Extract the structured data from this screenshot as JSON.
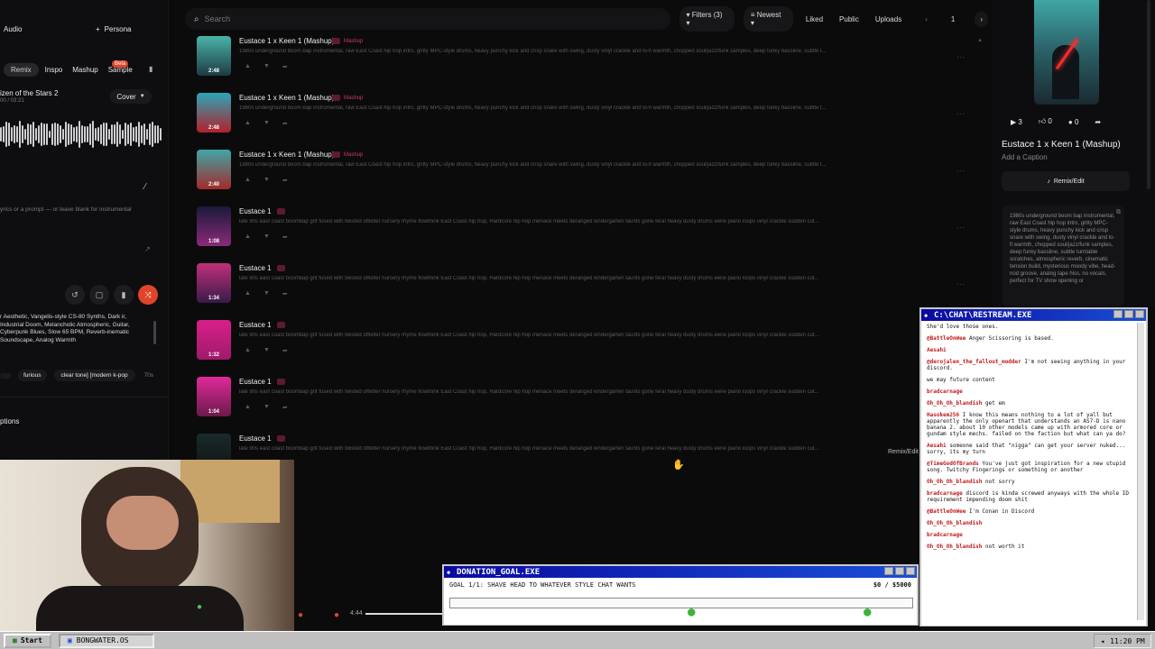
{
  "left": {
    "audio_label": "Audio",
    "persona_label": "Persona",
    "mode_tabs": [
      "Remix",
      "Inspo",
      "Mashup",
      "Sample"
    ],
    "beta_badge": "Beta",
    "track_title": "izen of the Stars 2",
    "track_time": "00 / 03:21",
    "cover_label": "Cover",
    "lyrics_placeholder": "yrics or a prompt — or leave blank for instrumental",
    "style_text": "r Aesthetic, Vangelis-style CS-80 Synths, Dark ir, Industrial Doom, Melancholic Atmospheric, Guitar, Cyberpunk Blues, Slow 65 BPM, Reverb-inematic Soundscape, Analog Warmth",
    "style_tags": [
      "furious",
      "clear tone] [modern k-pop",
      "70s"
    ],
    "options_label": "ptions"
  },
  "topbar": {
    "search_placeholder": "Search",
    "filters_label": "Filters (3)",
    "sort_label": "Newest",
    "liked_label": "Liked",
    "public_label": "Public",
    "uploads_label": "Uploads",
    "page_number": "1"
  },
  "songs": [
    {
      "title": "Eustace 1 x Keen 1 (Mashup)",
      "tag": "Mashup",
      "duration": "2:48",
      "desc": "1980s underground boom bap instrumental, raw East Coast hip hop intro, gritty MPC-style drums, heavy punchy kick and crisp snare with swing, dusty vinyl crackle and lo-fi warmth, chopped soul/jazz/funk samples, deep funky bassline, subtle t..."
    },
    {
      "title": "Eustace 1 x Keen 1 (Mashup)",
      "tag": "Mashup",
      "duration": "2:48",
      "desc": "1980s underground boom bap instrumental, raw East Coast hip hop intro, gritty MPC-style drums, heavy punchy kick and crisp snare with swing, dusty vinyl crackle and lo-fi warmth, chopped soul/jazz/funk samples, deep funky bassline, subtle t..."
    },
    {
      "title": "Eustace 1 x Keen 1 (Mashup)",
      "tag": "Mashup",
      "duration": "2:40",
      "desc": "1980s underground boom bap instrumental, raw East Coast hip hop intro, gritty MPC-style drums, heavy punchy kick and crisp snare with swing, dusty vinyl crackle and lo-fi warmth, chopped soul/jazz/funk samples, deep funky bassline, subtle t..."
    },
    {
      "title": "Eustace 1",
      "tag": "",
      "duration": "1:08",
      "desc": "late 90s east coast boombap grit fused with twisted offkilter nursery rhyme flowthink East Coast hip hop, Hardcore hip hop menace meets deranged kindergarten taunts gone feral heavy dusty drums eerie piano loops vinyl crackle sudden cut..."
    },
    {
      "title": "Eustace 1",
      "tag": "",
      "duration": "1:34",
      "desc": "late 90s east coast boombap grit fused with twisted offkilter nursery rhyme flowthink East Coast hip hop, Hardcore hip hop menace meets deranged kindergarten taunts gone feral heavy dusty drums eerie piano loops vinyl crackle sudden cut..."
    },
    {
      "title": "Eustace 1",
      "tag": "",
      "duration": "1:32",
      "desc": "late 90s east coast boombap grit fused with twisted offkilter nursery rhyme flowthink East Coast hip hop, Hardcore hip hop menace meets deranged kindergarten taunts gone feral heavy dusty drums eerie piano loops vinyl crackle sudden cut..."
    },
    {
      "title": "Eustace 1",
      "tag": "",
      "duration": "1:04",
      "desc": "late 90s east coast boombap grit fused with twisted offkilter nursery rhyme flowthink East Coast hip hop, Hardcore hip hop menace meets deranged kindergarten taunts gone feral heavy dusty drums eerie piano loops vinyl crackle sudden cut..."
    },
    {
      "title": "Eustace 1",
      "tag": "",
      "duration": "",
      "desc": "late 90s east coast boombap grit fused with twisted offkilter nursery rhyme flowthink East Coast hip hop, Hardcore hip hop menace meets deranged kindergarten taunts gone feral heavy dusty drums eerie piano loops vinyl crackle sudden cut..."
    }
  ],
  "remix_edit_hover": "Remix/Edit",
  "detail": {
    "plays": "3",
    "likes": "0",
    "comments": "0",
    "title": "Eustace 1 x Keen 1 (Mashup)",
    "caption": "Add a Caption",
    "remix_button": "Remix/Edit",
    "description": "1980s underground boom bap instrumental, raw East Coast hip hop intro, gritty MPC-style drums, heavy punchy kick and crisp snare with swing, dusty vinyl crackle and lo-fi warmth, chopped soul/jazz/funk samples, deep funky bassline, subtle turntable scratches, atmospheric reverb, cinematic tension build, mysterious moody vibe, head-nod groove, analog tape hiss, no vocals, perfect for TV show opening or"
  },
  "chat": {
    "title": "C:\\CHAT\\RESTREAM.EXE",
    "messages": [
      {
        "name": "",
        "text": "She'd love those ones."
      },
      {
        "name": "@BattleOnWee",
        "text": "Anger Scissoring is based."
      },
      {
        "name": "Aesahi",
        "text": ""
      },
      {
        "name": "@derojalen_the_fallout_modder",
        "text": "I'm not seeing anything in your discord."
      },
      {
        "name": "",
        "text": "we may future content"
      },
      {
        "name": "bradcarnage",
        "text": ""
      },
      {
        "name": "Oh_Oh_Oh_blandish",
        "text": "get em"
      },
      {
        "name": "Hasokem256",
        "text": "I know this means nothing to a lot of yall but apparently the only openart that understands an AS7-D is nano banana 2. about 10 other models came up with armored core or gundam style mechs. failed on the faction but what can ya do?"
      },
      {
        "name": "Aesahi",
        "text": "someone said that \"nigga\" can get your server nuked... sorry, its my turn"
      },
      {
        "name": "@TimeGodOfBrands",
        "text": "You've just got inspiration for a new stupid song. Twitchy Fingerings or something or another"
      },
      {
        "name": "Oh_Oh_Oh_blandish",
        "text": "not sorry"
      },
      {
        "name": "bradcarnage",
        "text": "discord is kinda screwed anyways with the whole ID requirement impending doom shit"
      },
      {
        "name": "@BattleOnWee",
        "text": "I'm Conan in Discord"
      },
      {
        "name": "Oh_Oh_Oh_blandish",
        "text": ""
      },
      {
        "name": "bradcarnage",
        "text": ""
      },
      {
        "name": "Oh_Oh_Oh_blandish",
        "text": "not worth it"
      }
    ]
  },
  "donation": {
    "title": "DONATION_GOAL.EXE",
    "goal_text": "GOAL 1/1: SHAVE HEAD TO WHATEVER STYLE CHAT WANTS",
    "amount": "$0 / $5000",
    "progress": 0
  },
  "player": {
    "time": "4:44"
  },
  "taskbar": {
    "start": "Start",
    "task": "BONGWATER.OS",
    "clock": "11:20 PM"
  },
  "colors": {
    "accent": "#e0452a",
    "chat_title": "#0a0aa0",
    "tag_pink": "#cc3a67"
  }
}
